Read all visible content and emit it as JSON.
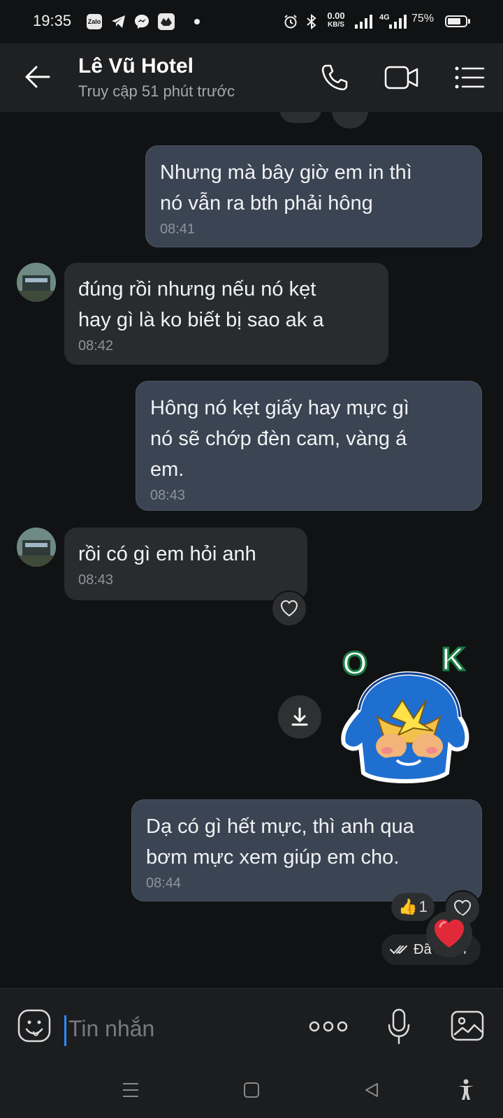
{
  "status_bar": {
    "time": "19:35",
    "apps": [
      "Zalo",
      "telegram-icon",
      "messenger-icon",
      "game-icon"
    ],
    "net_speed_value": "0.00",
    "net_speed_unit": "KB/S",
    "network": "4G",
    "battery": "75%",
    "battery_level": 0.75
  },
  "header": {
    "title": "Lê Vũ Hotel",
    "subtitle": "Truy cập 51 phút trước"
  },
  "messages": [
    {
      "side": "out",
      "text": "Nhưng mà bây giờ em in thì\nnó vẫn ra bth phải hông",
      "time": "08:41"
    },
    {
      "side": "in",
      "text": "đúng rồi nhưng nếu nó kẹt\nhay gì là ko biết bị sao ak a",
      "time": "08:42"
    },
    {
      "side": "out",
      "text": "Hông nó kẹt giấy hay mực gì\nnó sẽ chớp đèn cam, vàng á\nem.",
      "time": "08:43"
    },
    {
      "side": "in",
      "text": "rồi có gì em hỏi anh",
      "time": "08:43"
    },
    {
      "side": "out",
      "text": "Dạ có gì hết mực, thì anh qua\nbơm mực xem giúp em cho.",
      "time": "08:44"
    }
  ],
  "sticker": {
    "letters_left": "O",
    "letters_right": "K"
  },
  "reaction": {
    "emoji": "👍",
    "count": "1",
    "heart": "❤️"
  },
  "delivery_status": "Đã nhận",
  "input": {
    "placeholder": "Tin nhắn"
  },
  "colors": {
    "background": "#111213",
    "header": "#1f2022",
    "bubble_out": "#3a4452",
    "bubble_in": "#2a2b2d",
    "caret": "#2b8cff",
    "heart": "#e02a3a"
  }
}
